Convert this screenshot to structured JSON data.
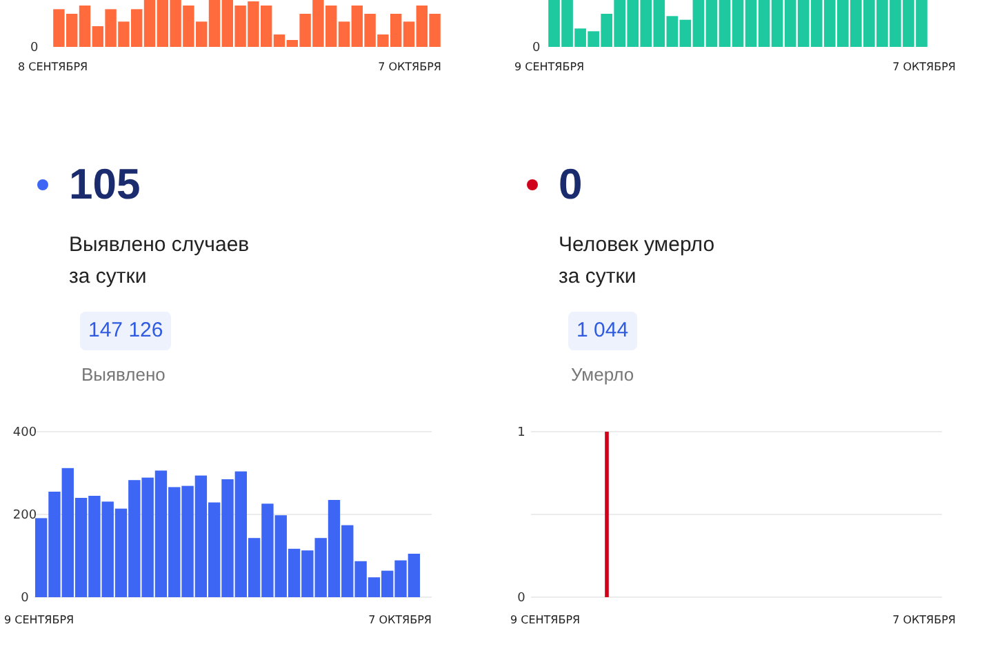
{
  "top_charts": [
    {
      "color": "#ff6b3d",
      "axis_label": "0",
      "start_date": "8 СЕНТЯБРЯ",
      "end_date": "7 ОКТЯБРЯ"
    },
    {
      "color": "#1ec9a0",
      "axis_label": "0",
      "start_date": "9 СЕНТЯБРЯ",
      "end_date": "7 ОКТЯБРЯ"
    }
  ],
  "stats": [
    {
      "color": "#3d66f5",
      "value": "105",
      "caption_lines": [
        "Выявлено случаев",
        "за сутки"
      ],
      "total": "147 126",
      "total_label": "Выявлено",
      "start_date": "9 СЕНТЯБРЯ",
      "end_date": "7 ОКТЯБРЯ",
      "chart_data": {
        "type": "bar",
        "series": [
          {
            "color": "#3d66f5",
            "values": [
              191,
              255,
              312,
              240,
              245,
              231,
              214,
              283,
              289,
              306,
              266,
              269,
              294,
              229,
              285,
              304,
              143,
              226,
              198,
              117,
              113,
              143,
              235,
              174,
              87,
              48,
              64,
              89,
              105
            ]
          }
        ],
        "ylim": [
          0,
          400
        ],
        "yticks": [
          0,
          200,
          400
        ]
      }
    },
    {
      "color": "#d0021b",
      "value": "0",
      "caption_lines": [
        "Человек умерло",
        "за сутки"
      ],
      "total": "1 044",
      "total_label": "Умерло",
      "start_date": "9 СЕНТЯБРЯ",
      "end_date": "7 ОКТЯБРЯ",
      "chart_data": {
        "type": "bar",
        "series": [
          {
            "color": "#d0021b",
            "values": [
              0,
              0,
              0,
              0,
              0,
              1,
              0,
              0,
              0,
              0,
              0,
              0,
              0,
              0,
              0,
              0,
              0,
              0,
              0,
              0,
              0,
              0,
              0,
              0,
              0,
              0,
              0,
              0,
              0
            ]
          }
        ],
        "ylim": [
          0,
          1
        ],
        "yticks": [
          0,
          1
        ]
      }
    }
  ]
}
